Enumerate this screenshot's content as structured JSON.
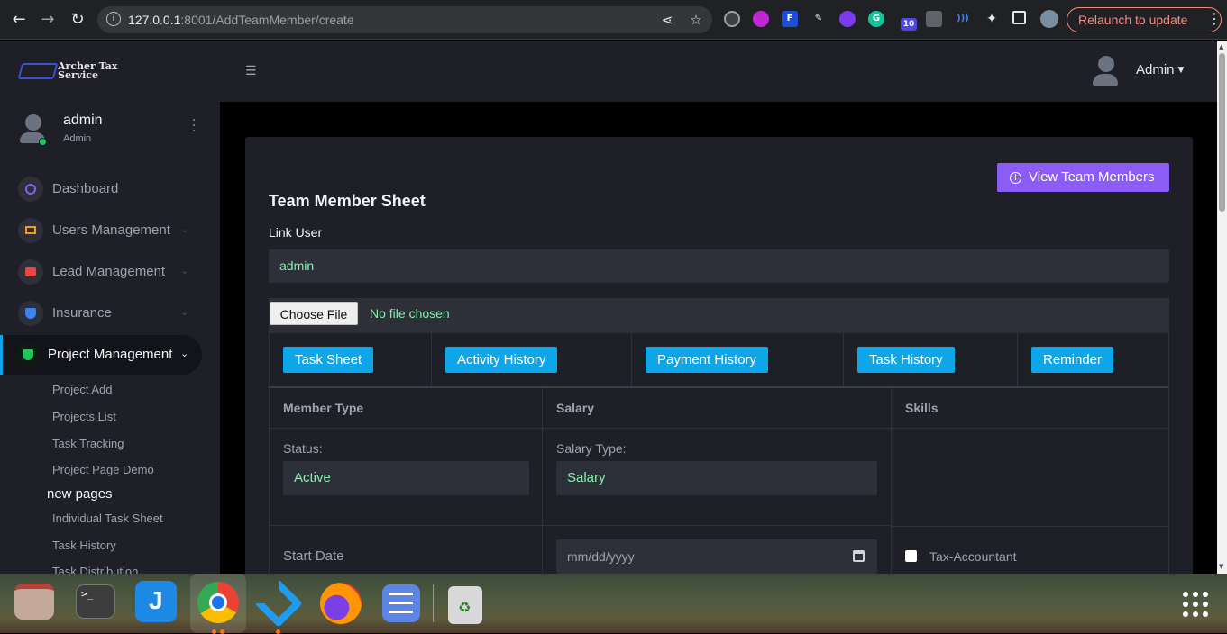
{
  "browser": {
    "url_host": "127.0.0.1",
    "url_rest": ":8001/AddTeamMember/create",
    "relaunch_label": "Relaunch to update",
    "ext_badge": "10"
  },
  "header": {
    "logo_line1": "Archer Tax",
    "logo_line2": "Service",
    "user_label": "Admin"
  },
  "sidebar": {
    "user_name": "admin",
    "user_role": "Admin",
    "menu": [
      {
        "label": "Dashboard",
        "color": "#8b5cf6"
      },
      {
        "label": "Users Management",
        "color": "#f59e0b"
      },
      {
        "label": "Lead Management",
        "color": "#ef4444"
      },
      {
        "label": "Insurance",
        "color": "#3b82f6"
      },
      {
        "label": "Project Management",
        "color": "#22c55e"
      }
    ],
    "sub_items": [
      "Project Add",
      "Projects List",
      "Task Tracking",
      "Project Page Demo"
    ],
    "section_label": "new pages",
    "section_items": [
      "Individual Task Sheet",
      "Task History",
      "Task Distribution"
    ]
  },
  "main": {
    "view_button": "View Team Members",
    "title": "Team Member Sheet",
    "link_label": "Link User",
    "link_value": "admin",
    "file_button": "Choose File",
    "file_status": "No file chosen",
    "tabs": [
      "Task Sheet",
      "Activity History",
      "Payment History",
      "Task History",
      "Reminder"
    ],
    "columns": [
      "Member Type",
      "Salary",
      "Skills"
    ],
    "status_label": "Status:",
    "status_value": "Active",
    "salary_type_label": "Salary Type:",
    "salary_type_value": "Salary",
    "start_date_label": "Start Date",
    "date_placeholder": "mm/dd/yyyy",
    "skill_checkbox": "Tax-Accountant"
  },
  "colors": {
    "accent_purple": "#8b5cf6",
    "accent_blue": "#0ea5e9",
    "value_green": "#86efac"
  }
}
